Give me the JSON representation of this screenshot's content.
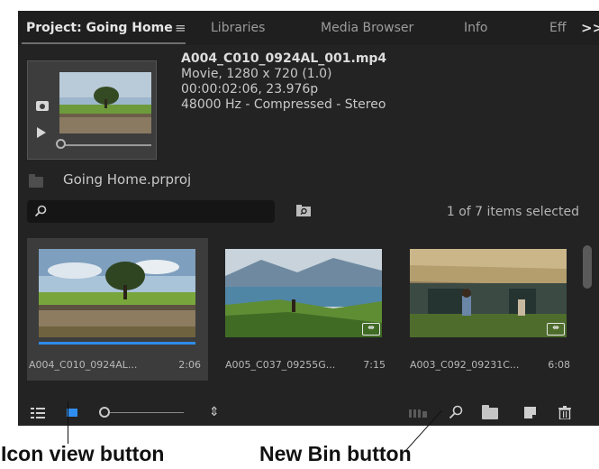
{
  "tabs": [
    {
      "label": "Project: Going Home",
      "active": true
    },
    {
      "label": "Libraries",
      "active": false
    },
    {
      "label": "Media Browser",
      "active": false
    },
    {
      "label": "Info",
      "active": false
    },
    {
      "label": "Eff",
      "active": false
    }
  ],
  "tab_menu_glyph": "≡",
  "tab_overflow_glyph": ">>",
  "preview": {
    "clip_name": "A004_C010_0924AL_001.mp4",
    "line2": "Movie, 1280 x 720 (1.0)",
    "line3": "00:00:02:06, 23.976p",
    "line4": "48000 Hz - Compressed - Stereo"
  },
  "project_file": "Going Home.prproj",
  "search": {
    "value": "",
    "placeholder": ""
  },
  "selection_status": "1 of 7 items selected",
  "clips": [
    {
      "label": "A004_C010_0924AL...",
      "duration": "2:06",
      "selected": true
    },
    {
      "label": "A005_C037_09255G...",
      "duration": "7:15",
      "selected": false
    },
    {
      "label": "A003_C092_09231C...",
      "duration": "6:08",
      "selected": false
    }
  ],
  "toolbar": {
    "sort_glyph": "⇕"
  },
  "icons": [
    "camera-icon",
    "play-icon",
    "folder-icon",
    "search-icon",
    "find-bin-icon",
    "list-view-icon",
    "icon-view-icon",
    "zoom-slider",
    "sort-icon",
    "automate-to-sequence-icon",
    "find-icon",
    "new-bin-icon",
    "new-item-icon",
    "trash-icon"
  ],
  "colors": {
    "accent": "#2f8ff0",
    "panel_bg": "#232323",
    "selected_clip_bg": "#3c3c3c"
  },
  "callouts": {
    "icon_view": "Icon view button",
    "new_bin": "New Bin button"
  }
}
